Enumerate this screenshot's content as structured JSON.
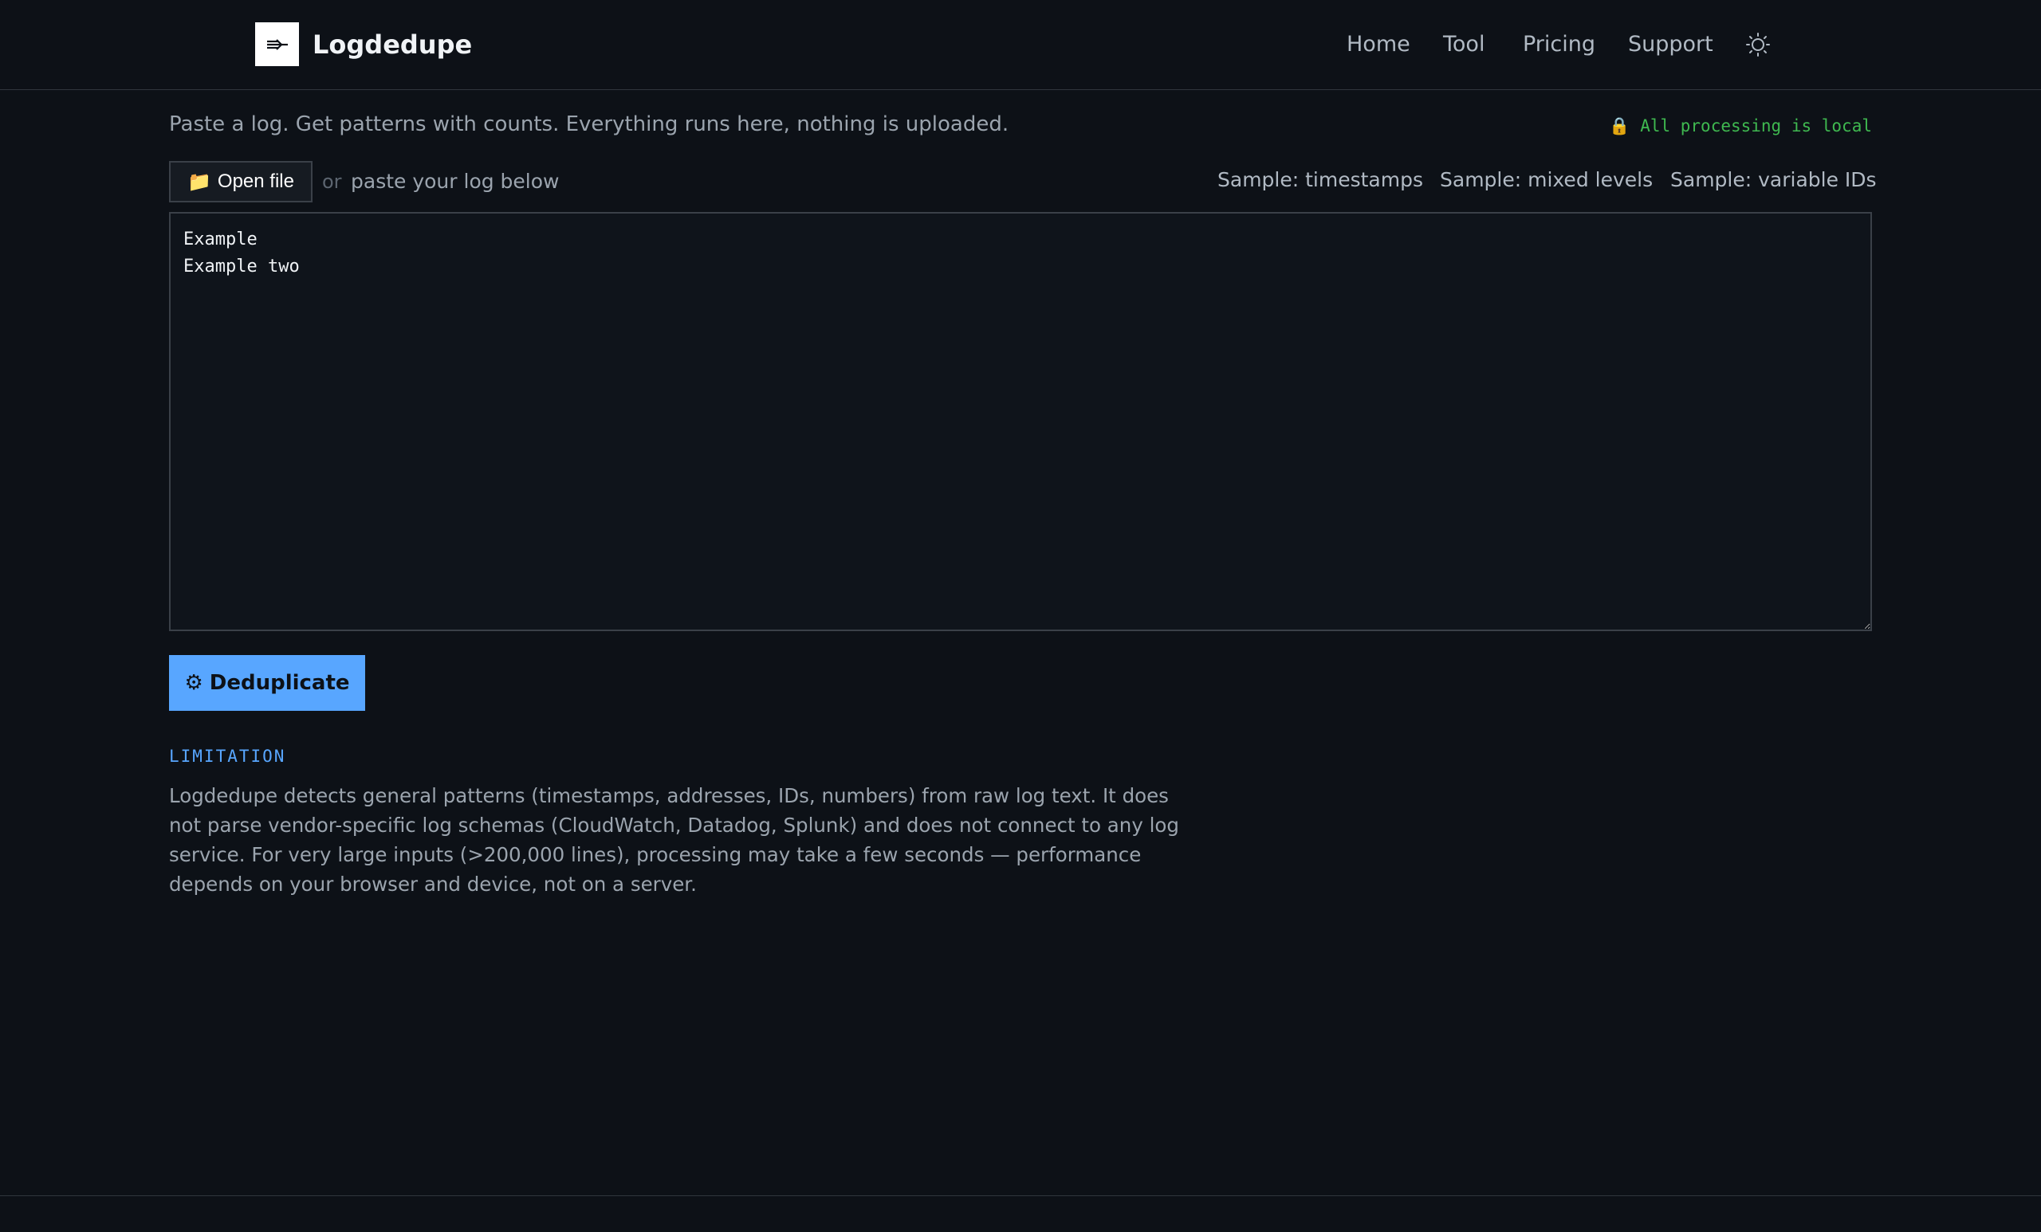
{
  "header": {
    "brand": "Logdedupe",
    "logo_icon": "arrow-into-bar-icon",
    "nav": {
      "home": "Home",
      "tool": "Tool",
      "pricing": "Pricing",
      "support": "Support"
    },
    "theme_icon": "sun-icon"
  },
  "main": {
    "tagline": "Paste a log. Get patterns with counts. Everything runs here, nothing is uploaded.",
    "local_badge": "🔒 All processing is local",
    "open_file": {
      "icon": "📁",
      "label": "Open file"
    },
    "or_text": "or",
    "paste_hint": "paste your log below",
    "samples": {
      "timestamps": "Sample: timestamps",
      "mixed_levels": "Sample: mixed levels",
      "variable_ids": "Sample: variable IDs"
    },
    "log_input": {
      "value": "Example\nExample two"
    },
    "dedupe_button": {
      "icon": "⚙",
      "label": "Deduplicate"
    },
    "limitation": {
      "label": "LIMITATION",
      "text": "Logdedupe detects general patterns (timestamps, addresses, IDs, numbers) from raw log text. It does not parse vendor-specific log schemas (CloudWatch, Datadog, Splunk) and does not connect to any log service. For very large inputs (>200,000 lines), processing may take a few seconds — performance depends on your browser and device, not on a server."
    }
  },
  "colors": {
    "background": "#0d1117",
    "accent": "#58a6ff",
    "success": "#3fb950",
    "border": "#30363d"
  }
}
